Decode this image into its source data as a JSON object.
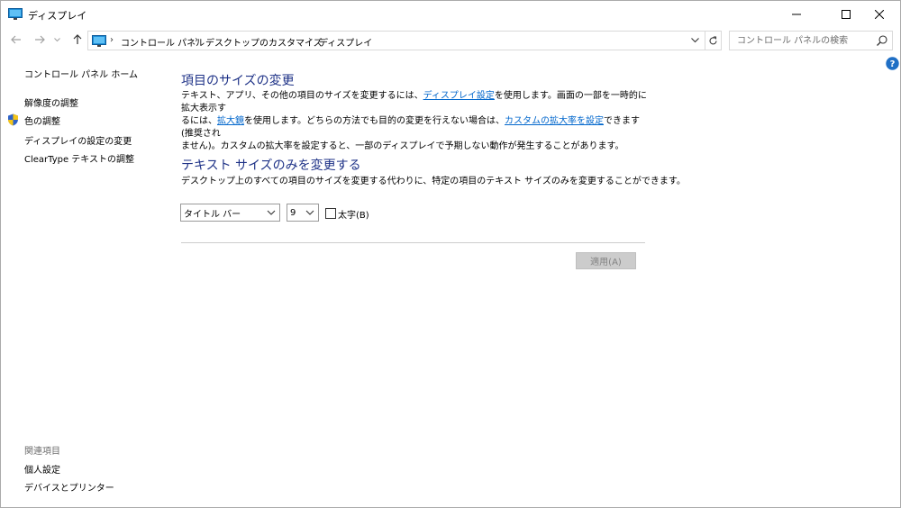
{
  "window": {
    "title": "ディスプレイ"
  },
  "navbar": {
    "breadcrumbs": [
      "コントロール パネル",
      "デスクトップのカスタマイズ",
      "ディスプレイ"
    ],
    "search_placeholder": "コントロール パネルの検索"
  },
  "sidebar": {
    "home": "コントロール パネル ホーム",
    "items": [
      "解像度の調整",
      "色の調整",
      "ディスプレイの設定の変更",
      "ClearType テキストの調整"
    ],
    "related_heading": "関連項目",
    "related_items": [
      "個人設定",
      "デバイスとプリンター"
    ]
  },
  "main": {
    "section1": {
      "heading": "項目のサイズの変更",
      "p1_a": "テキスト、アプリ、その他の項目のサイズを変更するには、",
      "p1_link1": "ディスプレイ設定",
      "p1_b": "を使用します。画面の一部を一時的に拡大表示す",
      "p1_c": "るには、",
      "p1_link2": "拡大鏡",
      "p1_d": "を使用します。どちらの方法でも目的の変更を行えない場合は、",
      "p1_link3": "カスタムの拡大率を設定",
      "p1_e": "できます (推奨され",
      "p1_f": "ません)。カスタムの拡大率を設定すると、一部のディスプレイで予期しない動作が発生することがあります。"
    },
    "section2": {
      "heading": "テキスト サイズのみを変更する",
      "description": "デスクトップ上のすべての項目のサイズを変更する代わりに、特定の項目のテキスト サイズのみを変更することができます。",
      "item_select_value": "タイトル バー",
      "size_select_value": "9",
      "bold_label": "太字(B)",
      "bold_checked": false,
      "apply_label": "適用(A)"
    }
  },
  "colors": {
    "heading": "#1e3287",
    "link": "#0066cc",
    "apply_disabled_bg": "#cccccc"
  }
}
